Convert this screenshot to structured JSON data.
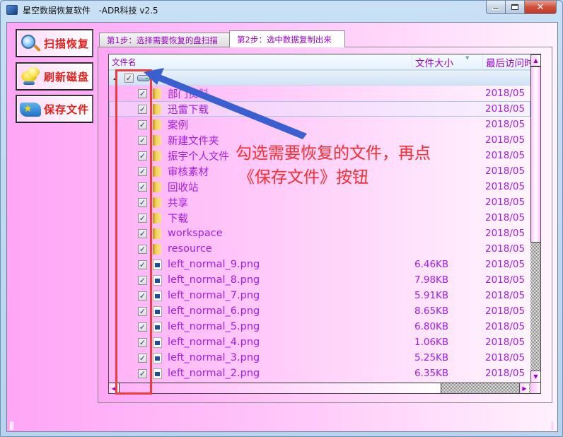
{
  "window": {
    "title": "星空数据恢复软件   -ADR科技 v2.5",
    "controls": [
      "minimize",
      "maximize",
      "close"
    ]
  },
  "sidebar": {
    "buttons": [
      {
        "label": "扫描恢复",
        "icon": "magnifier-icon"
      },
      {
        "label": "刷新磁盘",
        "icon": "refresh-bubbles-icon"
      },
      {
        "label": "保存文件",
        "icon": "save-star-icon"
      }
    ]
  },
  "tabs": [
    {
      "label": "第1步：选择需要恢复的盘扫描",
      "active": false
    },
    {
      "label": "第2步：选中数据复制出来",
      "active": true
    }
  ],
  "list": {
    "columns": {
      "name": "文件名",
      "size": "文件大小",
      "date": "最后访问时"
    },
    "drive": {
      "label": ":",
      "checked": true,
      "expanded": true
    },
    "rows": [
      {
        "type": "folder",
        "name": "部门资料",
        "size": "",
        "date": "2018/05",
        "checked": true
      },
      {
        "type": "folder",
        "name": "迅雷下载",
        "size": "",
        "date": "2018/05",
        "checked": true,
        "selected": true
      },
      {
        "type": "folder",
        "name": "案例",
        "size": "",
        "date": "2018/05",
        "checked": true
      },
      {
        "type": "folder",
        "name": "新建文件夹",
        "size": "",
        "date": "2018/05",
        "checked": true
      },
      {
        "type": "folder",
        "name": "振宇个人文件",
        "size": "",
        "date": "2018/05",
        "checked": true
      },
      {
        "type": "folder",
        "name": "审核素材",
        "size": "",
        "date": "2018/05",
        "checked": true
      },
      {
        "type": "folder",
        "name": "回收站",
        "size": "",
        "date": "2018/05",
        "checked": true
      },
      {
        "type": "folder",
        "name": "共享",
        "size": "",
        "date": "2018/05",
        "checked": true
      },
      {
        "type": "folder",
        "name": "下载",
        "size": "",
        "date": "2018/05",
        "checked": true
      },
      {
        "type": "folder",
        "name": "workspace",
        "size": "",
        "date": "2018/05",
        "checked": true
      },
      {
        "type": "folder",
        "name": "resource",
        "size": "",
        "date": "2018/05",
        "checked": true
      },
      {
        "type": "file",
        "name": "left_normal_9.png",
        "size": "6.46KB",
        "date": "2018/05",
        "checked": true
      },
      {
        "type": "file",
        "name": "left_normal_8.png",
        "size": "7.98KB",
        "date": "2018/05",
        "checked": true
      },
      {
        "type": "file",
        "name": "left_normal_7.png",
        "size": "5.91KB",
        "date": "2018/05",
        "checked": true
      },
      {
        "type": "file",
        "name": "left_normal_6.png",
        "size": "8.65KB",
        "date": "2018/05",
        "checked": true
      },
      {
        "type": "file",
        "name": "left_normal_5.png",
        "size": "6.80KB",
        "date": "2018/05",
        "checked": true
      },
      {
        "type": "file",
        "name": "left_normal_4.png",
        "size": "1.06KB",
        "date": "2018/05",
        "checked": true
      },
      {
        "type": "file",
        "name": "left_normal_3.png",
        "size": "5.25KB",
        "date": "2018/05",
        "checked": true
      },
      {
        "type": "file",
        "name": "left_normal_2.png",
        "size": "6.35KB",
        "date": "2018/05",
        "checked": true
      }
    ]
  },
  "annotation": {
    "line1": "勾选需要恢复的文件，再点",
    "line2": "《保存文件》按钮",
    "color": "#f0323a"
  },
  "colors": {
    "accent_text": "#a21ee6",
    "button_text": "#e4211b",
    "highlight_box": "#f03c3c",
    "arrow": "#3a5fd0"
  }
}
